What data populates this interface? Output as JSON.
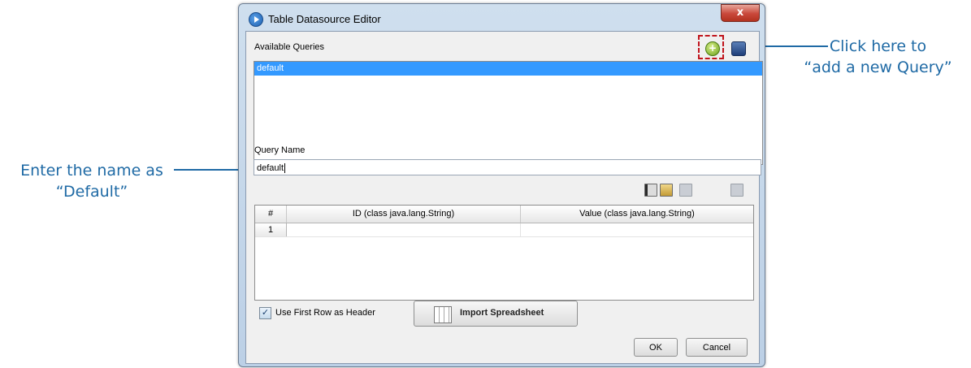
{
  "annotations": {
    "left_line1": "Enter the name as",
    "left_line2": "“Default”",
    "right_line1": "Click here to",
    "right_line2": "“add a new Query”"
  },
  "window": {
    "title": "Table Datasource Editor",
    "close_symbol": "x"
  },
  "queries": {
    "label": "Available Queries",
    "items": [
      "default"
    ],
    "selected_index": 0,
    "add_symbol": "+"
  },
  "query_name": {
    "label": "Query Name",
    "value": "default"
  },
  "toolbar_icons": [
    "insert-row-icon",
    "edit-icon",
    "disabled-table-icon",
    "disabled-table-icon"
  ],
  "table": {
    "headers": [
      "#",
      "ID (class java.lang.String)",
      "Value (class java.lang.String)"
    ],
    "rows": [
      {
        "num": "1",
        "id": "",
        "value": ""
      }
    ]
  },
  "footer": {
    "checkbox_label": "Use First Row as Header",
    "checkbox_checked": true,
    "import_label": "Import Spreadsheet",
    "ok_label": "OK",
    "cancel_label": "Cancel"
  },
  "colors": {
    "annotation": "#1f6aa5",
    "selection": "#3399ff",
    "highlight": "#c0141c"
  }
}
